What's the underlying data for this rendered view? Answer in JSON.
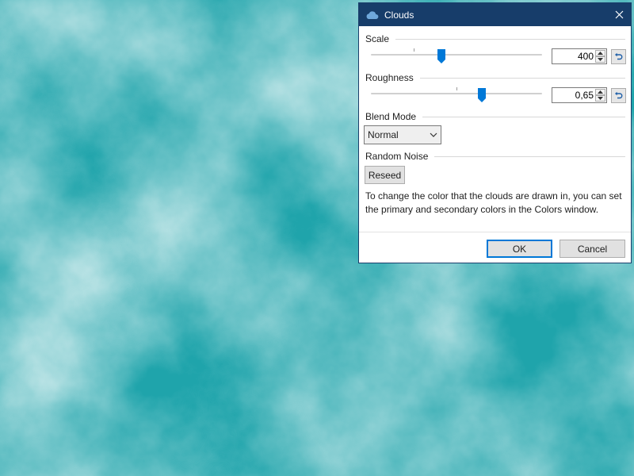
{
  "dialog": {
    "title": "Clouds",
    "scale": {
      "label": "Scale",
      "value": "400",
      "slider_fraction": 0.41
    },
    "roughness": {
      "label": "Roughness",
      "value": "0,65",
      "slider_fraction": 0.65
    },
    "blend_mode": {
      "label": "Blend Mode",
      "selected": "Normal"
    },
    "random_noise": {
      "label": "Random Noise",
      "reseed_label": "Reseed"
    },
    "description": "To change the color that the clouds are drawn in, you can set the primary and secondary colors in the Colors window.",
    "ok_label": "OK",
    "cancel_label": "Cancel"
  },
  "colors": {
    "titlebar": "#173d6a",
    "accent": "#0078d7",
    "cloud_dark": "#1aa0a8",
    "cloud_light": "#f4fbfb"
  }
}
